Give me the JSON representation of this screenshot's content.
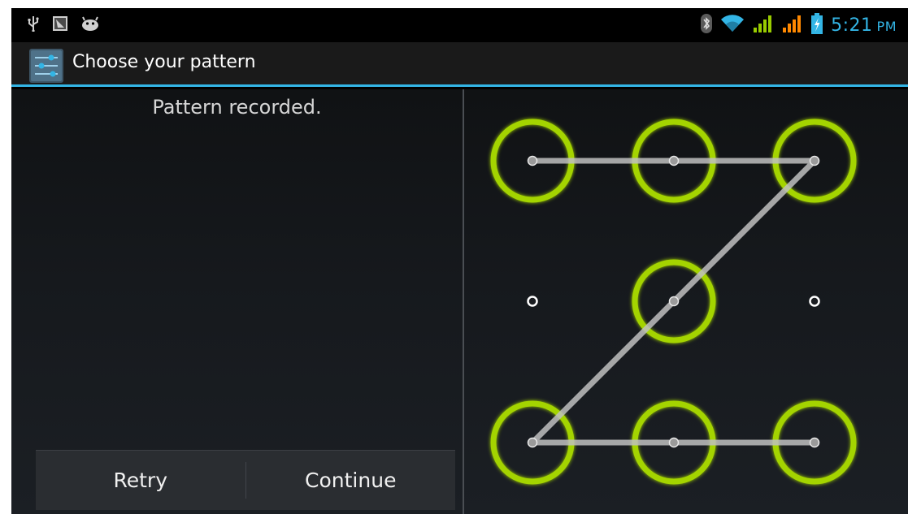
{
  "status_bar": {
    "left_icons": [
      "usb-icon",
      "screenshot-icon",
      "android-debug-icon"
    ],
    "right_icons": [
      "bluetooth-icon",
      "wifi-icon",
      "signal-icon",
      "signal-icon-2",
      "battery-charging-icon"
    ],
    "time": "5:21",
    "ampm": "PM",
    "accent_color": "#33b5e5"
  },
  "action_bar": {
    "title": "Choose your pattern",
    "icon": "settings-icon"
  },
  "main": {
    "header_text": "Pattern recorded.",
    "buttons": {
      "retry_label": "Retry",
      "continue_label": "Continue"
    }
  },
  "pattern": {
    "grid_rows": 3,
    "grid_cols": 3,
    "sequence": [
      1,
      2,
      3,
      5,
      7,
      8,
      9
    ],
    "active_ring_color": "#a4d400",
    "path_color": "#bfbfbf"
  }
}
